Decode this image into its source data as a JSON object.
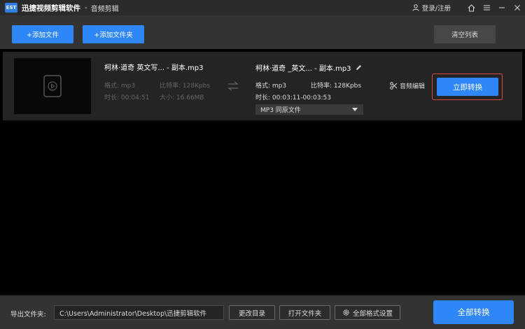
{
  "titlebar": {
    "logo_text": "EST",
    "app_name": "迅捷视频剪辑软件",
    "separator": "-",
    "module": "音频剪辑",
    "login_label": "登录/注册"
  },
  "toolbar": {
    "add_file_label": "+添加文件",
    "add_folder_label": "+添加文件夹",
    "clear_list_label": "清空列表"
  },
  "item": {
    "source": {
      "filename": "柯林·道奇 英文写... - 副本.mp3",
      "format_label": "格式: mp3",
      "bitrate_label": "比特率: 128Kpbs",
      "duration_label": "时长: 00:04:51",
      "size_label": "大小: 16.66MB"
    },
    "output": {
      "filename": "柯林·道奇 _英文... - 副本.mp3",
      "format_label": "格式: mp3",
      "bitrate_label": "比特率: 128Kpbs",
      "duration_label": "时长: 00:03:11-00:03:53",
      "format_select": "MP3 同原文件"
    },
    "audio_edit_label": "音频编辑",
    "convert_now_label": "立即转换"
  },
  "bottom": {
    "output_folder_label": "导出文件夹:",
    "output_path": "C:\\Users\\Administrator\\Desktop\\迅捷剪辑软件",
    "change_dir_label": "更改目录",
    "open_folder_label": "打开文件夹",
    "format_settings_label": "全部格式设置",
    "convert_all_label": "全部转换"
  },
  "colors": {
    "accent": "#2f86f6",
    "highlight": "#e04a3f",
    "titlebar": "#2b2b2b",
    "panel": "#333333",
    "item_bg": "#242424"
  },
  "icons": [
    "app-logo-icon",
    "user-icon",
    "home-icon",
    "menu-icon",
    "minimize-icon",
    "close-icon",
    "play-circle-icon",
    "convert-arrows-icon",
    "edit-pencil-icon",
    "scissors-icon",
    "dropdown-caret-icon",
    "gear-icon"
  ]
}
